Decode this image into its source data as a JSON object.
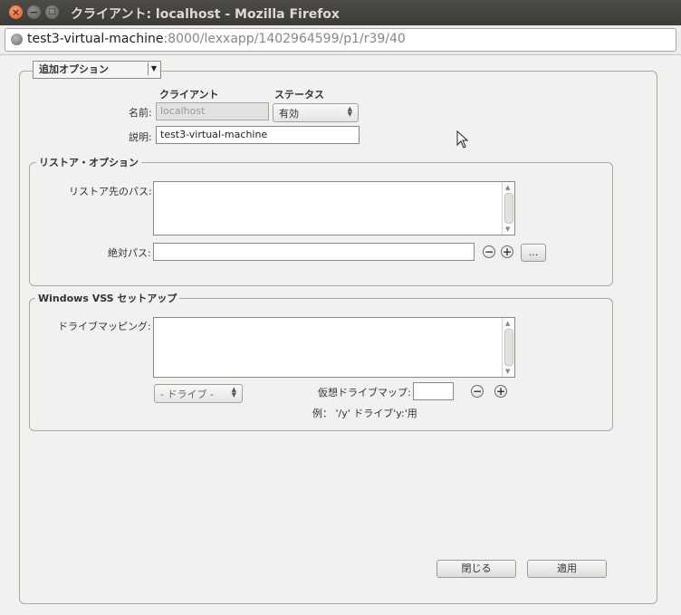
{
  "window": {
    "title": "クライアント: localhost - Mozilla Firefox"
  },
  "address_bar": {
    "host": "test3-virtual-machine",
    "rest": ":8000/lexxapp/1402964599/p1/r39/40"
  },
  "options_dropdown": {
    "selected": "追加オプション"
  },
  "client_section": {
    "client_header": "クライアント",
    "status_header": "ステータス",
    "name_label": "名前:",
    "name_value": "localhost",
    "status_value": "有効",
    "description_label": "説明:",
    "description_value": "test3-virtual-machine"
  },
  "restore_options": {
    "title": "リストア・オプション",
    "restore_path_label": "リストア先のパス:",
    "absolute_path_label": "絶対パス:",
    "absolute_path_value": "",
    "browse_label": "..."
  },
  "vss_setup": {
    "title": "Windows VSS セットアップ",
    "drive_mapping_label": "ドライブマッピング:",
    "drive_select_value": "- ドライブ -",
    "virtual_drive_label": "仮想ドライブマップ:",
    "virtual_drive_value": "",
    "example_text": "例： '/y' ドライブ'y:'用"
  },
  "footer": {
    "close_label": "閉じる",
    "apply_label": "適用"
  }
}
